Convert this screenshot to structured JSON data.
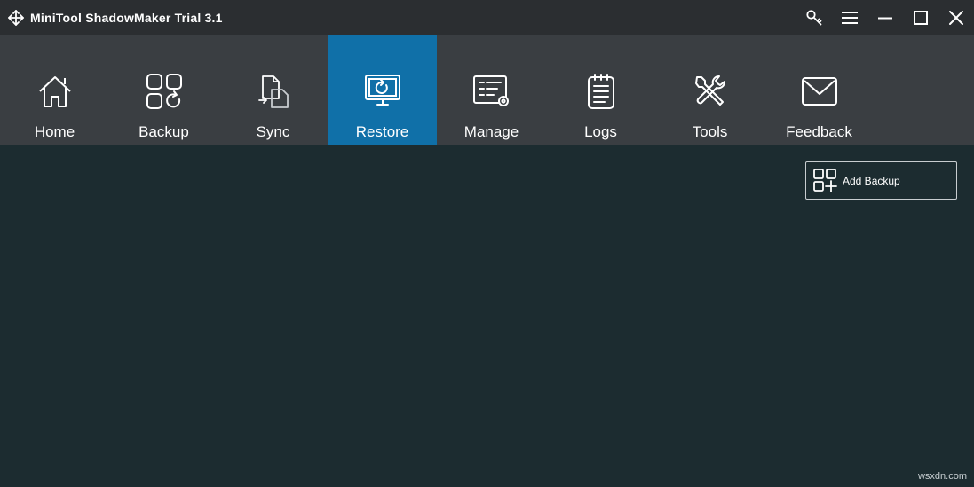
{
  "window": {
    "title": "MiniTool ShadowMaker Trial 3.1",
    "logo_icon": "minitool-logo-icon",
    "controls": [
      {
        "name": "register-key-icon"
      },
      {
        "name": "menu-icon"
      },
      {
        "name": "minimize-icon"
      },
      {
        "name": "maximize-icon"
      },
      {
        "name": "close-icon"
      }
    ]
  },
  "nav": {
    "active": "Restore",
    "active_color": "#1070a8",
    "items": [
      {
        "label": "Home",
        "icon": "home-icon"
      },
      {
        "label": "Backup",
        "icon": "backup-icon"
      },
      {
        "label": "Sync",
        "icon": "sync-icon"
      },
      {
        "label": "Restore",
        "icon": "restore-icon"
      },
      {
        "label": "Manage",
        "icon": "manage-icon"
      },
      {
        "label": "Logs",
        "icon": "logs-icon"
      },
      {
        "label": "Tools",
        "icon": "tools-icon"
      },
      {
        "label": "Feedback",
        "icon": "feedback-icon"
      }
    ]
  },
  "main": {
    "add_backup_label": "Add Backup",
    "add_backup_icon": "add-backup-icon"
  },
  "watermark": "wsxdn.com",
  "colors": {
    "titlebar": "#2b2e31",
    "navbar": "#3a3e42",
    "content": "#1c2c30"
  }
}
